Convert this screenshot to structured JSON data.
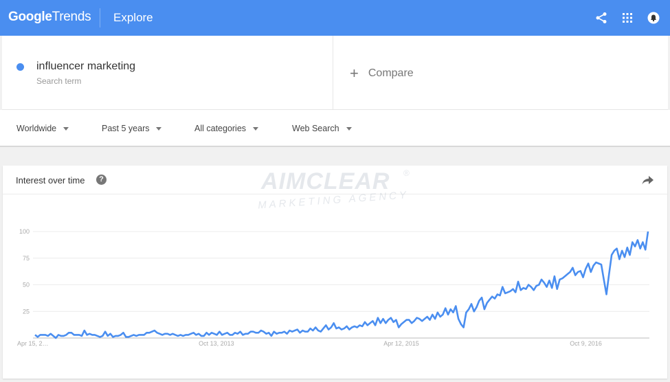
{
  "header": {
    "logo_google": "Google",
    "logo_trends": "Trends",
    "section": "Explore",
    "icons": [
      "share-icon",
      "apps-grid-icon",
      "notifications-icon"
    ]
  },
  "search": {
    "term": "influencer marketing",
    "term_type": "Search term",
    "term_color": "#4a8ef0",
    "compare_label": "Compare"
  },
  "filters": [
    {
      "label": "Worldwide"
    },
    {
      "label": "Past 5 years"
    },
    {
      "label": "All categories"
    },
    {
      "label": "Web Search"
    }
  ],
  "card": {
    "title": "Interest over time",
    "help_icon": "help-icon",
    "share_icon": "share-arrow-icon"
  },
  "watermark": {
    "main": "AIMCLEAR",
    "reg": "®",
    "sub": "MARKETING AGENCY"
  },
  "chart_data": {
    "type": "line",
    "title": "Interest over time",
    "xlabel": "",
    "ylabel": "",
    "ylim": [
      0,
      100
    ],
    "yticks": [
      25,
      50,
      75,
      100
    ],
    "xtick_labels": [
      "Apr 15, 2…",
      "Oct 13, 2013",
      "Apr 12, 2015",
      "Oct 9, 2016"
    ],
    "grid": true,
    "series": [
      {
        "name": "influencer marketing",
        "color": "#4a8ef0",
        "values": [
          3,
          1,
          3,
          3,
          3,
          2,
          4,
          2,
          0,
          3,
          2,
          2,
          3,
          5,
          5,
          3,
          3,
          3,
          2,
          7,
          3,
          4,
          3,
          3,
          2,
          1,
          2,
          6,
          2,
          4,
          1,
          2,
          2,
          3,
          5,
          1,
          1,
          2,
          3,
          2,
          3,
          3,
          3,
          5,
          5,
          6,
          7,
          5,
          4,
          3,
          4,
          4,
          3,
          4,
          3,
          2,
          3,
          2,
          3,
          3,
          4,
          5,
          3,
          4,
          2,
          2,
          5,
          3,
          5,
          4,
          3,
          6,
          3,
          4,
          5,
          3,
          3,
          5,
          4,
          6,
          3,
          4,
          4,
          6,
          6,
          5,
          5,
          7,
          6,
          4,
          5,
          2,
          6,
          4,
          5,
          5,
          6,
          4,
          7,
          6,
          7,
          8,
          5,
          7,
          6,
          6,
          9,
          7,
          10,
          7,
          6,
          9,
          12,
          8,
          10,
          14,
          9,
          10,
          8,
          9,
          11,
          8,
          10,
          11,
          10,
          12,
          11,
          15,
          12,
          14,
          16,
          12,
          19,
          14,
          18,
          14,
          17,
          19,
          15,
          17,
          10,
          13,
          15,
          17,
          17,
          14,
          16,
          19,
          18,
          16,
          18,
          20,
          17,
          22,
          18,
          24,
          20,
          22,
          28,
          22,
          27,
          24,
          30,
          18,
          13,
          10,
          24,
          27,
          32,
          25,
          29,
          35,
          38,
          27,
          33,
          36,
          39,
          37,
          41,
          40,
          48,
          42,
          43,
          44,
          46,
          43,
          53,
          45,
          47,
          46,
          50,
          48,
          45,
          49,
          50,
          55,
          52,
          48,
          54,
          47,
          58,
          46,
          55,
          56,
          58,
          60,
          62,
          66,
          59,
          62,
          63,
          57,
          65,
          70,
          62,
          68,
          71,
          70,
          69,
          55,
          41,
          60,
          78,
          82,
          84,
          74,
          82,
          76,
          85,
          78,
          90,
          86,
          92,
          84,
          90,
          83,
          100
        ]
      }
    ]
  }
}
